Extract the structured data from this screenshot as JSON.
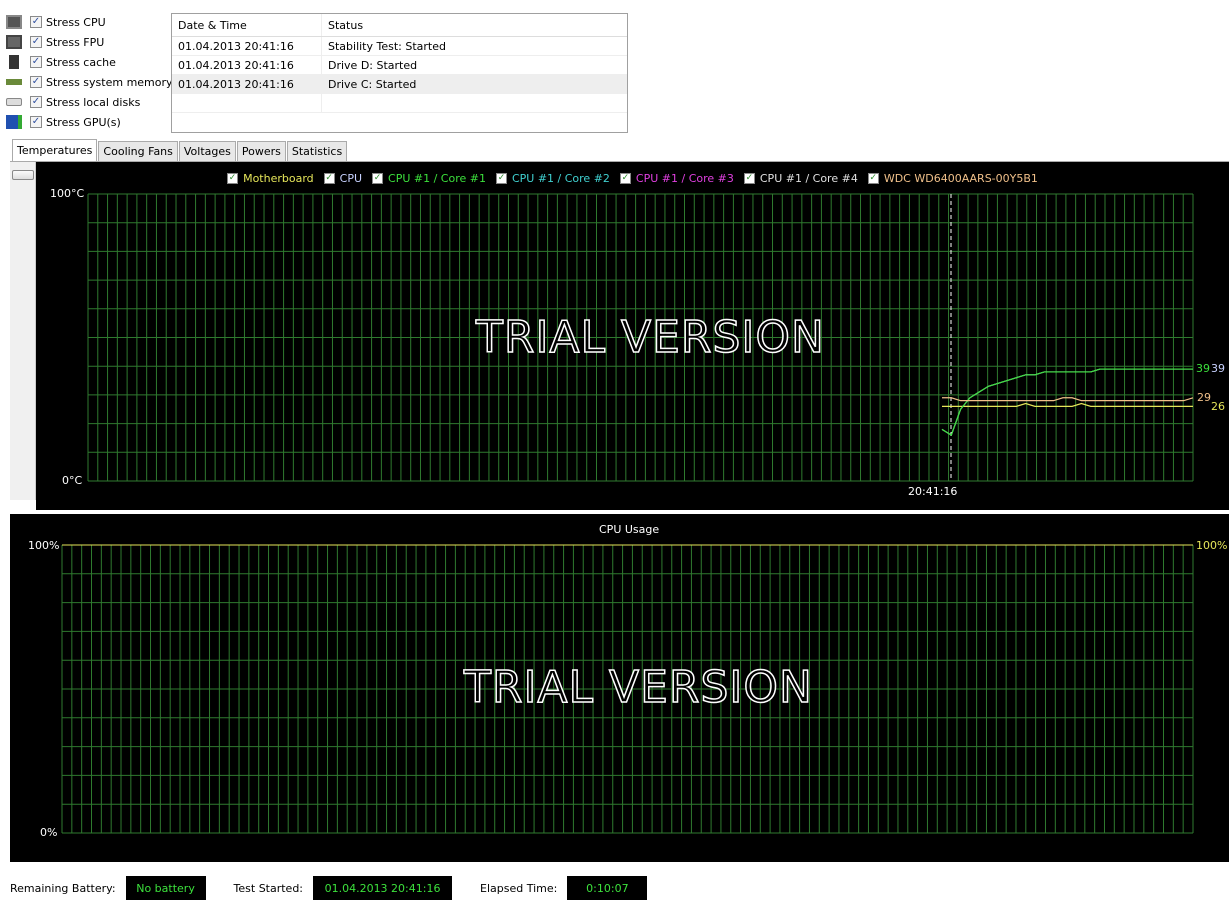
{
  "stress_options": [
    {
      "label": "Stress CPU",
      "checked": true,
      "icon": "cpu-icon"
    },
    {
      "label": "Stress FPU",
      "checked": true,
      "icon": "fpu-icon"
    },
    {
      "label": "Stress cache",
      "checked": true,
      "icon": "cache-icon"
    },
    {
      "label": "Stress system memory",
      "checked": true,
      "icon": "memory-icon"
    },
    {
      "label": "Stress local disks",
      "checked": true,
      "icon": "disk-icon"
    },
    {
      "label": "Stress GPU(s)",
      "checked": true,
      "icon": "gpu-icon"
    }
  ],
  "log": {
    "headers": [
      "Date & Time",
      "Status"
    ],
    "rows": [
      [
        "01.04.2013 20:41:16",
        "Stability Test: Started"
      ],
      [
        "01.04.2013 20:41:16",
        "Drive D: Started"
      ],
      [
        "01.04.2013 20:41:16",
        "Drive C: Started"
      ]
    ]
  },
  "tabs": [
    "Temperatures",
    "Cooling Fans",
    "Voltages",
    "Powers",
    "Statistics"
  ],
  "watermark": "TRIAL VERSION",
  "chart_data": [
    {
      "type": "line",
      "title": "",
      "ymax_label": "100°C",
      "ymin_label": "0°C",
      "ylim": [
        0,
        100
      ],
      "x_marker_label": "20:41:16",
      "grid": true,
      "series": [
        {
          "name": "Motherboard",
          "color": "#e6e65a",
          "values": [
            26,
            26,
            26,
            26,
            26,
            26,
            26,
            26,
            26,
            27,
            26,
            26,
            26,
            26,
            26,
            27,
            26,
            26,
            26,
            26,
            26,
            26,
            26,
            26,
            26,
            26,
            26,
            26
          ],
          "end_label": "26"
        },
        {
          "name": "CPU",
          "color": "#c8d2ff",
          "values": [
            18,
            16,
            25,
            29,
            31,
            33,
            34,
            35,
            36,
            37,
            37,
            38,
            38,
            38,
            38,
            38,
            38,
            39,
            39,
            39,
            39,
            39,
            39,
            39,
            39,
            39,
            39,
            39
          ],
          "end_label": "39"
        },
        {
          "name": "CPU #1 / Core #1",
          "color": "#3ce03c",
          "values": [
            18,
            16,
            25,
            29,
            31,
            33,
            34,
            35,
            36,
            37,
            37,
            38,
            38,
            38,
            38,
            38,
            38,
            39,
            39,
            39,
            39,
            39,
            39,
            39,
            39,
            39,
            39,
            39
          ],
          "end_label": "39"
        },
        {
          "name": "CPU #1 / Core #2",
          "color": "#40d0d0",
          "values": []
        },
        {
          "name": "CPU #1 / Core #3",
          "color": "#e040e0",
          "values": []
        },
        {
          "name": "CPU #1 / Core #4",
          "color": "#e0e0e0",
          "values": []
        },
        {
          "name": "WDC WD6400AARS-00Y5B1",
          "color": "#f0c08a",
          "values": [
            29,
            29,
            28,
            28,
            28,
            28,
            28,
            28,
            28,
            28,
            28,
            28,
            28,
            29,
            29,
            28,
            28,
            28,
            28,
            28,
            28,
            28,
            28,
            28,
            28,
            28,
            28,
            29
          ],
          "end_label": "29"
        }
      ]
    },
    {
      "type": "line",
      "title": "CPU Usage",
      "ymax_label": "100%",
      "ymin_label": "0%",
      "ylim": [
        0,
        100
      ],
      "right_label": "100%",
      "grid": true,
      "series": [
        {
          "name": "CPU Usage",
          "color": "#e6e65a",
          "values": [
            100
          ]
        }
      ]
    }
  ],
  "status": {
    "battery_label": "Remaining Battery:",
    "battery_value": "No battery",
    "started_label": "Test Started:",
    "started_value": "01.04.2013 20:41:16",
    "elapsed_label": "Elapsed Time:",
    "elapsed_value": "0:10:07"
  }
}
